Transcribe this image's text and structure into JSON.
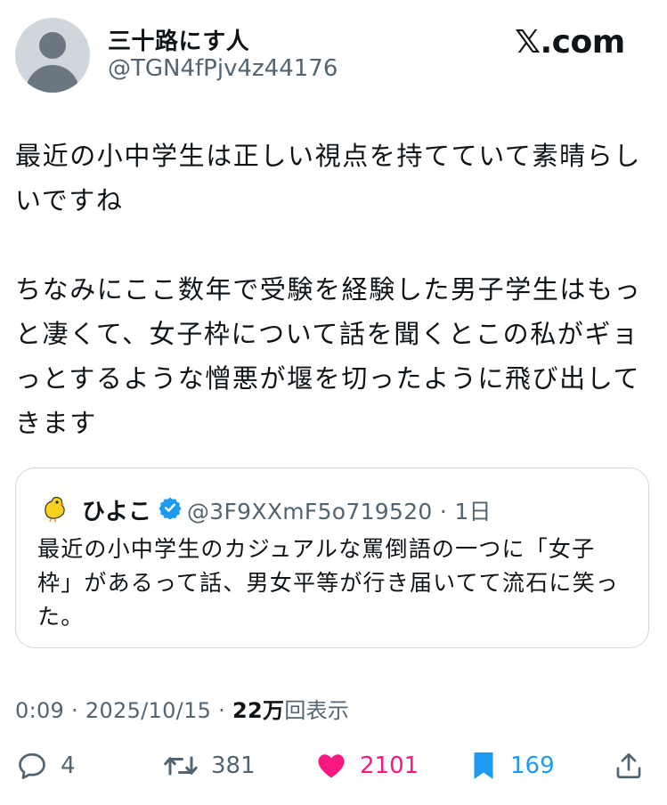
{
  "author": {
    "display_name": "三十路にす人",
    "handle": "@TGN4fPjv4z44176"
  },
  "brand": "𝕏.com",
  "post": {
    "text": "最近の小中学生は正しい視点を持てていて素晴らしいですね\n\nちなみにここ数年で受験を経験した男子学生はもっと凄くて、女子枠について話を聞くとこの私がギョっとするような憎悪が堰を切ったように飛び出してきます"
  },
  "quoted": {
    "name": "ひよこ",
    "handle_time": "@3F9XXmF5o719520 · 1日",
    "text": "最近の小中学生のカジュアルな罵倒語の一つに「女子枠」があるって話、男女平等が行き届いてて流石に笑った。"
  },
  "meta": {
    "time_date": "0:09 · 2025/10/15 · ",
    "views_count": "22万",
    "views_label": "回表示"
  },
  "actions": {
    "replies": "4",
    "reposts": "381",
    "likes": "2101",
    "bookmarks": "169"
  },
  "colors": {
    "like": "#f91880",
    "bookmark": "#1d9bf0",
    "verified": "#1d9bf0",
    "secondary_text": "#536471"
  },
  "icons": [
    "default-avatar-icon",
    "chick-avatar-icon",
    "verified-badge-icon",
    "reply-icon",
    "repost-icon",
    "like-icon",
    "bookmark-icon",
    "share-icon"
  ]
}
